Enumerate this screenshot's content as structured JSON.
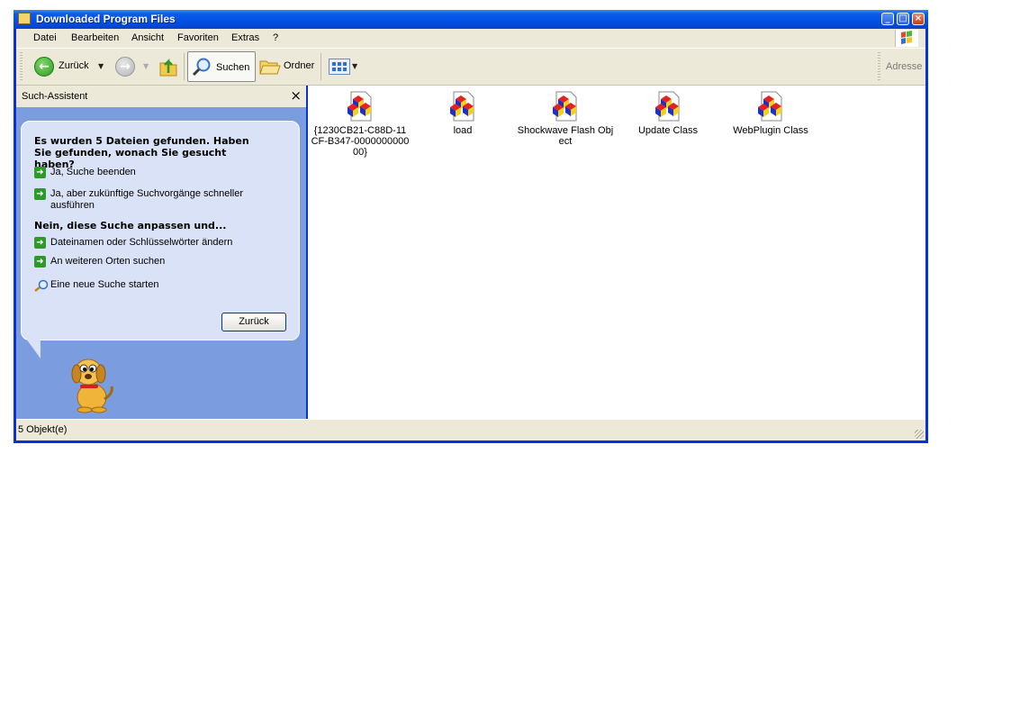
{
  "window": {
    "title": "Downloaded Program Files"
  },
  "menu": [
    {
      "label": "Datei"
    },
    {
      "label": "Bearbeiten"
    },
    {
      "label": "Ansicht"
    },
    {
      "label": "Favoriten"
    },
    {
      "label": "Extras"
    },
    {
      "label": "?"
    }
  ],
  "toolbar": {
    "back_label": "Zurück",
    "search_label": "Suchen",
    "folders_label": "Ordner",
    "address_label": "Adresse"
  },
  "search_pane": {
    "title": "Such-Assistent",
    "close_glyph": "×",
    "found_text": "Es wurden 5 Dateien gefunden. Haben Sie gefunden, wonach Sie gesucht haben?",
    "link_yes_end": "Ja, Suche beenden",
    "link_yes_faster": "Ja, aber zukünftige Suchvorgänge schneller ausführen",
    "refine_heading": "Nein, diese Suche anpassen und...",
    "link_change_names": "Dateinamen oder Schlüsselwörter ändern",
    "link_other_places": "An weiteren Orten suchen",
    "link_new_search": "Eine neue Suche starten",
    "back_button": "Zurück"
  },
  "files": [
    {
      "name": "{1230CB21-C88D-11CF-B347-000000000000}"
    },
    {
      "name": "load"
    },
    {
      "name": "Shockwave Flash Object"
    },
    {
      "name": "Update Class"
    },
    {
      "name": "WebPlugin Class"
    }
  ],
  "status": {
    "count_text": "5 Objekt(e)"
  }
}
